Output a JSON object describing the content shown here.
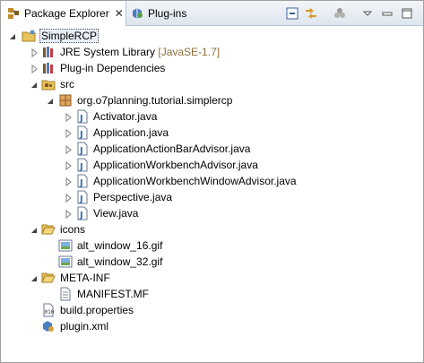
{
  "tabs": {
    "package_explorer": {
      "label": "Package Explorer",
      "close": "✕"
    },
    "plugins": {
      "label": "Plug-ins"
    }
  },
  "toolbar": {
    "icons": [
      "collapse-all-icon",
      "link-with-editor-icon",
      "focus-task-icon",
      "view-menu-icon",
      "minimize-icon",
      "maximize-icon"
    ]
  },
  "tree": {
    "project": "SimpleRCP",
    "jre": {
      "name": "JRE System Library",
      "decoration": "[JavaSE-1.7]"
    },
    "plugin_deps": "Plug-in Dependencies",
    "src": "src",
    "package": "org.o7planning.tutorial.simplercp",
    "java_files": [
      "Activator.java",
      "Application.java",
      "ApplicationActionBarAdvisor.java",
      "ApplicationWorkbenchAdvisor.java",
      "ApplicationWorkbenchWindowAdvisor.java",
      "Perspective.java",
      "View.java"
    ],
    "icons_folder": "icons",
    "icon_files": [
      "alt_window_16.gif",
      "alt_window_32.gif"
    ],
    "meta_inf": "META-INF",
    "manifest": "MANIFEST.MF",
    "build_properties": "build.properties",
    "plugin_xml": "plugin.xml"
  },
  "colors": {
    "tab_gradient_top": "#f3f5f8",
    "tab_gradient_bottom": "#dfe6ef",
    "decoration": "#8c6f3a",
    "folder": "#e8c35a",
    "java_icon": "#3b6fb6"
  }
}
